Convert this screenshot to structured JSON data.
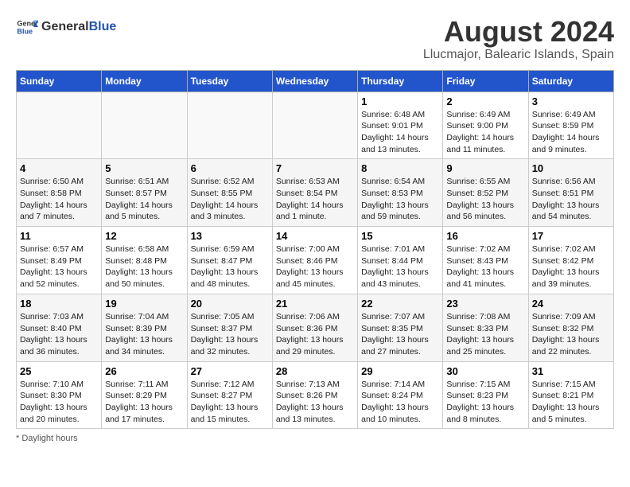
{
  "header": {
    "logo_general": "General",
    "logo_blue": "Blue",
    "title": "August 2024",
    "subtitle": "Llucmajor, Balearic Islands, Spain"
  },
  "days_of_week": [
    "Sunday",
    "Monday",
    "Tuesday",
    "Wednesday",
    "Thursday",
    "Friday",
    "Saturday"
  ],
  "weeks": [
    [
      {
        "day": "",
        "info": ""
      },
      {
        "day": "",
        "info": ""
      },
      {
        "day": "",
        "info": ""
      },
      {
        "day": "",
        "info": ""
      },
      {
        "day": "1",
        "info": "Sunrise: 6:48 AM\nSunset: 9:01 PM\nDaylight: 14 hours\nand 13 minutes."
      },
      {
        "day": "2",
        "info": "Sunrise: 6:49 AM\nSunset: 9:00 PM\nDaylight: 14 hours\nand 11 minutes."
      },
      {
        "day": "3",
        "info": "Sunrise: 6:49 AM\nSunset: 8:59 PM\nDaylight: 14 hours\nand 9 minutes."
      }
    ],
    [
      {
        "day": "4",
        "info": "Sunrise: 6:50 AM\nSunset: 8:58 PM\nDaylight: 14 hours\nand 7 minutes."
      },
      {
        "day": "5",
        "info": "Sunrise: 6:51 AM\nSunset: 8:57 PM\nDaylight: 14 hours\nand 5 minutes."
      },
      {
        "day": "6",
        "info": "Sunrise: 6:52 AM\nSunset: 8:55 PM\nDaylight: 14 hours\nand 3 minutes."
      },
      {
        "day": "7",
        "info": "Sunrise: 6:53 AM\nSunset: 8:54 PM\nDaylight: 14 hours\nand 1 minute."
      },
      {
        "day": "8",
        "info": "Sunrise: 6:54 AM\nSunset: 8:53 PM\nDaylight: 13 hours\nand 59 minutes."
      },
      {
        "day": "9",
        "info": "Sunrise: 6:55 AM\nSunset: 8:52 PM\nDaylight: 13 hours\nand 56 minutes."
      },
      {
        "day": "10",
        "info": "Sunrise: 6:56 AM\nSunset: 8:51 PM\nDaylight: 13 hours\nand 54 minutes."
      }
    ],
    [
      {
        "day": "11",
        "info": "Sunrise: 6:57 AM\nSunset: 8:49 PM\nDaylight: 13 hours\nand 52 minutes."
      },
      {
        "day": "12",
        "info": "Sunrise: 6:58 AM\nSunset: 8:48 PM\nDaylight: 13 hours\nand 50 minutes."
      },
      {
        "day": "13",
        "info": "Sunrise: 6:59 AM\nSunset: 8:47 PM\nDaylight: 13 hours\nand 48 minutes."
      },
      {
        "day": "14",
        "info": "Sunrise: 7:00 AM\nSunset: 8:46 PM\nDaylight: 13 hours\nand 45 minutes."
      },
      {
        "day": "15",
        "info": "Sunrise: 7:01 AM\nSunset: 8:44 PM\nDaylight: 13 hours\nand 43 minutes."
      },
      {
        "day": "16",
        "info": "Sunrise: 7:02 AM\nSunset: 8:43 PM\nDaylight: 13 hours\nand 41 minutes."
      },
      {
        "day": "17",
        "info": "Sunrise: 7:02 AM\nSunset: 8:42 PM\nDaylight: 13 hours\nand 39 minutes."
      }
    ],
    [
      {
        "day": "18",
        "info": "Sunrise: 7:03 AM\nSunset: 8:40 PM\nDaylight: 13 hours\nand 36 minutes."
      },
      {
        "day": "19",
        "info": "Sunrise: 7:04 AM\nSunset: 8:39 PM\nDaylight: 13 hours\nand 34 minutes."
      },
      {
        "day": "20",
        "info": "Sunrise: 7:05 AM\nSunset: 8:37 PM\nDaylight: 13 hours\nand 32 minutes."
      },
      {
        "day": "21",
        "info": "Sunrise: 7:06 AM\nSunset: 8:36 PM\nDaylight: 13 hours\nand 29 minutes."
      },
      {
        "day": "22",
        "info": "Sunrise: 7:07 AM\nSunset: 8:35 PM\nDaylight: 13 hours\nand 27 minutes."
      },
      {
        "day": "23",
        "info": "Sunrise: 7:08 AM\nSunset: 8:33 PM\nDaylight: 13 hours\nand 25 minutes."
      },
      {
        "day": "24",
        "info": "Sunrise: 7:09 AM\nSunset: 8:32 PM\nDaylight: 13 hours\nand 22 minutes."
      }
    ],
    [
      {
        "day": "25",
        "info": "Sunrise: 7:10 AM\nSunset: 8:30 PM\nDaylight: 13 hours\nand 20 minutes."
      },
      {
        "day": "26",
        "info": "Sunrise: 7:11 AM\nSunset: 8:29 PM\nDaylight: 13 hours\nand 17 minutes."
      },
      {
        "day": "27",
        "info": "Sunrise: 7:12 AM\nSunset: 8:27 PM\nDaylight: 13 hours\nand 15 minutes."
      },
      {
        "day": "28",
        "info": "Sunrise: 7:13 AM\nSunset: 8:26 PM\nDaylight: 13 hours\nand 13 minutes."
      },
      {
        "day": "29",
        "info": "Sunrise: 7:14 AM\nSunset: 8:24 PM\nDaylight: 13 hours\nand 10 minutes."
      },
      {
        "day": "30",
        "info": "Sunrise: 7:15 AM\nSunset: 8:23 PM\nDaylight: 13 hours\nand 8 minutes."
      },
      {
        "day": "31",
        "info": "Sunrise: 7:15 AM\nSunset: 8:21 PM\nDaylight: 13 hours\nand 5 minutes."
      }
    ]
  ],
  "footer": "Daylight hours"
}
